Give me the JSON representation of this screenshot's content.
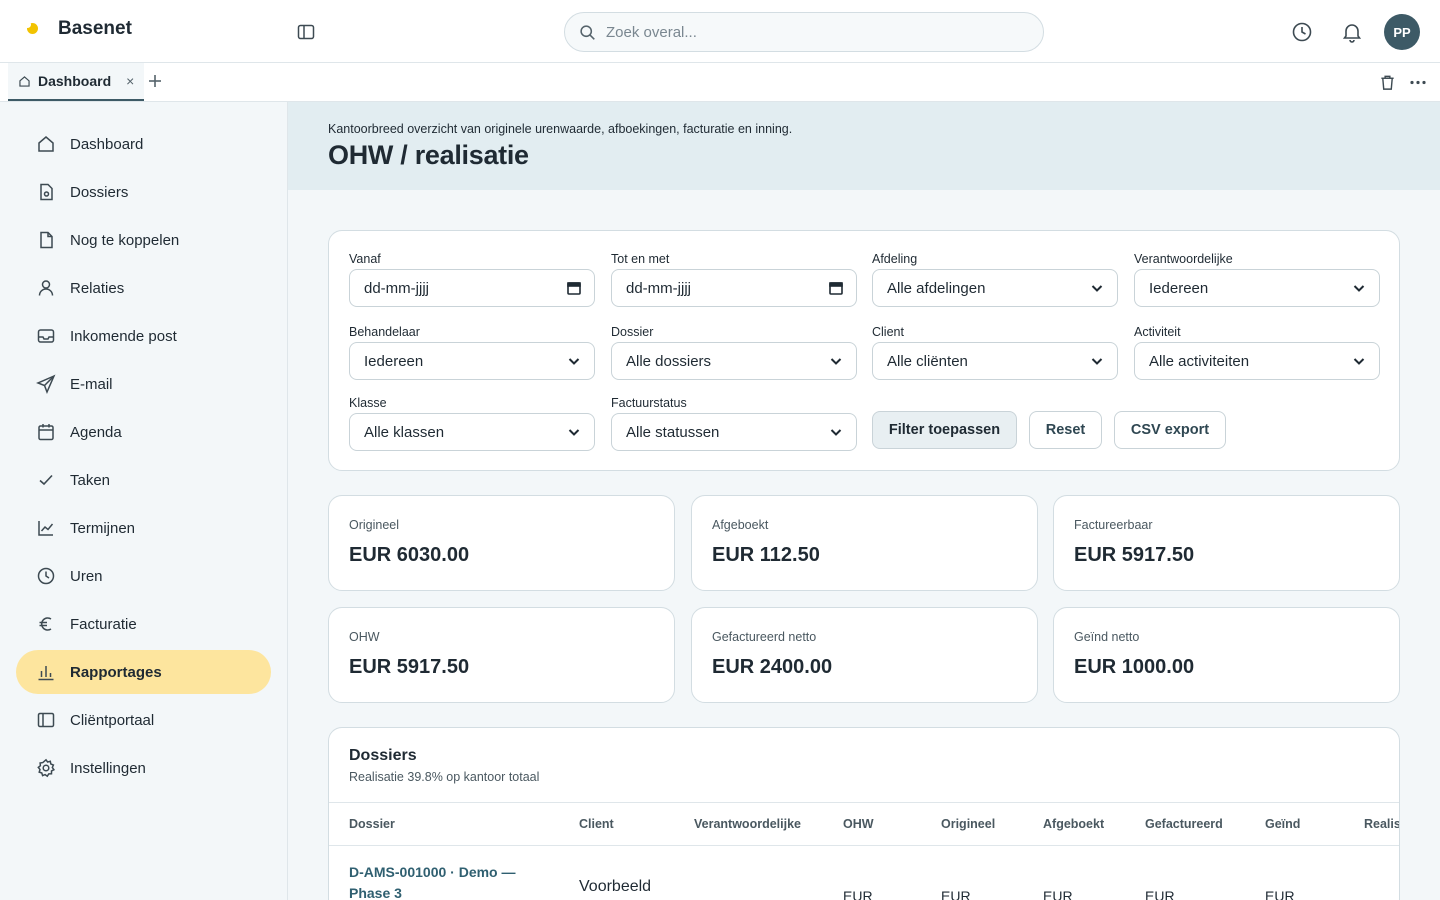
{
  "app": {
    "name": "Basenet",
    "user_initials": "PP"
  },
  "search": {
    "placeholder": "Zoek overal..."
  },
  "tabs": {
    "items": [
      {
        "label": "Dashboard",
        "close": "×"
      }
    ]
  },
  "sidebar": {
    "items": [
      {
        "label": "Dashboard",
        "icon": "home-icon"
      },
      {
        "label": "Dossiers",
        "icon": "file-icon"
      },
      {
        "label": "Nog te koppelen",
        "icon": "document-icon"
      },
      {
        "label": "Relaties",
        "icon": "user-icon"
      },
      {
        "label": "Inkomende post",
        "icon": "inbox-icon"
      },
      {
        "label": "E-mail",
        "icon": "send-icon"
      },
      {
        "label": "Agenda",
        "icon": "calendar-icon"
      },
      {
        "label": "Taken",
        "icon": "check-icon"
      },
      {
        "label": "Termijnen",
        "icon": "chart-line-icon"
      },
      {
        "label": "Uren",
        "icon": "clock-icon"
      },
      {
        "label": "Facturatie",
        "icon": "euro-icon"
      },
      {
        "label": "Rapportages",
        "icon": "bar-chart-icon",
        "active": true
      },
      {
        "label": "Cliëntportaal",
        "icon": "panel-icon"
      },
      {
        "label": "Instellingen",
        "icon": "gear-icon"
      }
    ]
  },
  "page": {
    "subtitle": "Kantoorbreed overzicht van originele urenwaarde, afboekingen, facturatie en inning.",
    "title": "OHW / realisatie"
  },
  "filters": {
    "fields": [
      {
        "label": "Vanaf",
        "value": "dd-mm-jjjj",
        "type": "date"
      },
      {
        "label": "Tot en met",
        "value": "dd-mm-jjjj",
        "type": "date"
      },
      {
        "label": "Afdeling",
        "value": "Alle afdelingen",
        "type": "select"
      },
      {
        "label": "Verantwoordelijke",
        "value": "Iedereen",
        "type": "select"
      },
      {
        "label": "Behandelaar",
        "value": "Iedereen",
        "type": "select"
      },
      {
        "label": "Dossier",
        "value": "Alle dossiers",
        "type": "select"
      },
      {
        "label": "Client",
        "value": "Alle cliënten",
        "type": "select"
      },
      {
        "label": "Activiteit",
        "value": "Alle activiteiten",
        "type": "select"
      },
      {
        "label": "Klasse",
        "value": "Alle klassen",
        "type": "select"
      },
      {
        "label": "Factuurstatus",
        "value": "Alle statussen",
        "type": "select"
      }
    ],
    "buttons": {
      "apply": "Filter toepassen",
      "reset": "Reset",
      "export": "CSV export"
    }
  },
  "kpis": [
    {
      "label": "Origineel",
      "value": "EUR 6030.00"
    },
    {
      "label": "Afgeboekt",
      "value": "EUR 112.50"
    },
    {
      "label": "Factureerbaar",
      "value": "EUR 5917.50"
    },
    {
      "label": "OHW",
      "value": "EUR 5917.50"
    },
    {
      "label": "Gefactureerd netto",
      "value": "EUR 2400.00"
    },
    {
      "label": "Geïnd netto",
      "value": "EUR 1000.00"
    }
  ],
  "dossiers": {
    "title": "Dossiers",
    "subtitle": "Realisatie 39.8% op kantoor totaal",
    "columns": [
      "Dossier",
      "Client",
      "Verantwoordelijke",
      "OHW",
      "Origineel",
      "Afgeboekt",
      "Gefactureerd",
      "Geïnd",
      "Realis"
    ],
    "rows": [
      {
        "dossier": "D-AMS-001000 · Demo — Phase 3",
        "client": "Voorbeeld",
        "ohw": "EUR",
        "origineel": "EUR",
        "afgeboekt": "EUR",
        "gefactureerd": "EUR",
        "geind": "EUR"
      }
    ]
  },
  "colors": {
    "accent_active": "#fde59e",
    "brand": "#f2c300",
    "avatar": "#3d5a66",
    "link": "#2f5f70"
  }
}
